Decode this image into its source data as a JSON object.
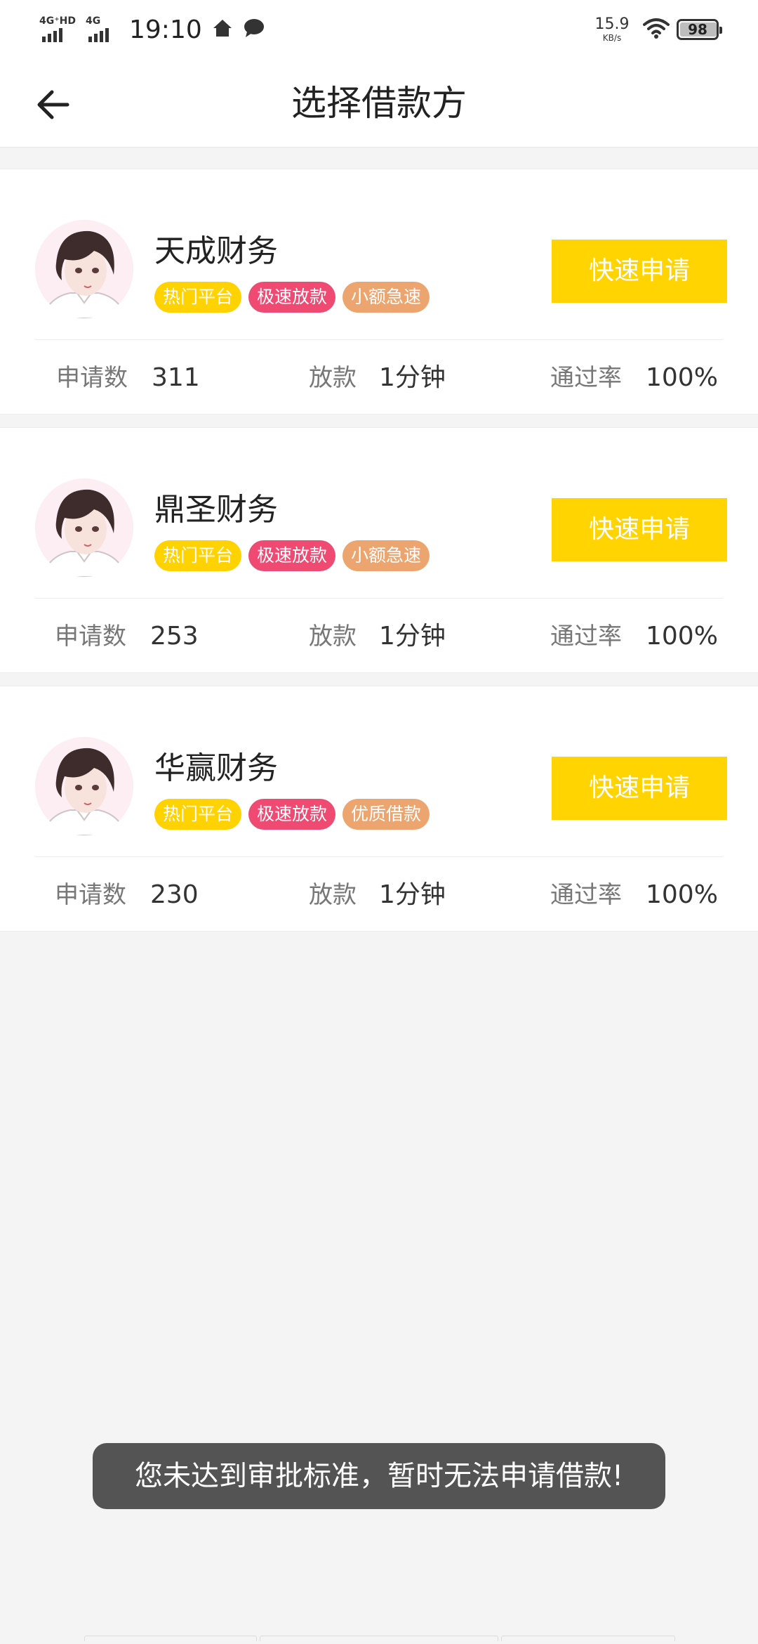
{
  "status_bar": {
    "net1": "4G⁺HD",
    "net2": "4G",
    "time": "19:10",
    "speed": "15.9",
    "speed_unit": "KB/s",
    "battery": "98"
  },
  "header": {
    "title": "选择借款方"
  },
  "lenders": [
    {
      "name": "天成财务",
      "tags": [
        "热门平台",
        "极速放款",
        "小额急速"
      ],
      "apply_label": "快速申请",
      "applications_label": "申请数",
      "applications": "311",
      "payout_label": "放款",
      "payout": "1分钟",
      "pass_rate_label": "通过率",
      "pass_rate": "100%"
    },
    {
      "name": "鼎圣财务",
      "tags": [
        "热门平台",
        "极速放款",
        "小额急速"
      ],
      "apply_label": "快速申请",
      "applications_label": "申请数",
      "applications": "253",
      "payout_label": "放款",
      "payout": "1分钟",
      "pass_rate_label": "通过率",
      "pass_rate": "100%"
    },
    {
      "name": "华赢财务",
      "tags": [
        "热门平台",
        "极速放款",
        "优质借款"
      ],
      "apply_label": "快速申请",
      "applications_label": "申请数",
      "applications": "230",
      "payout_label": "放款",
      "payout": "1分钟",
      "pass_rate_label": "通过率",
      "pass_rate": "100%"
    }
  ],
  "tag_colors": [
    "#ffd200",
    "#ef4a72",
    "#eca56e"
  ],
  "accent_color": "#ffd400",
  "toast": "您未达到审批标准，暂时无法申请借款!"
}
